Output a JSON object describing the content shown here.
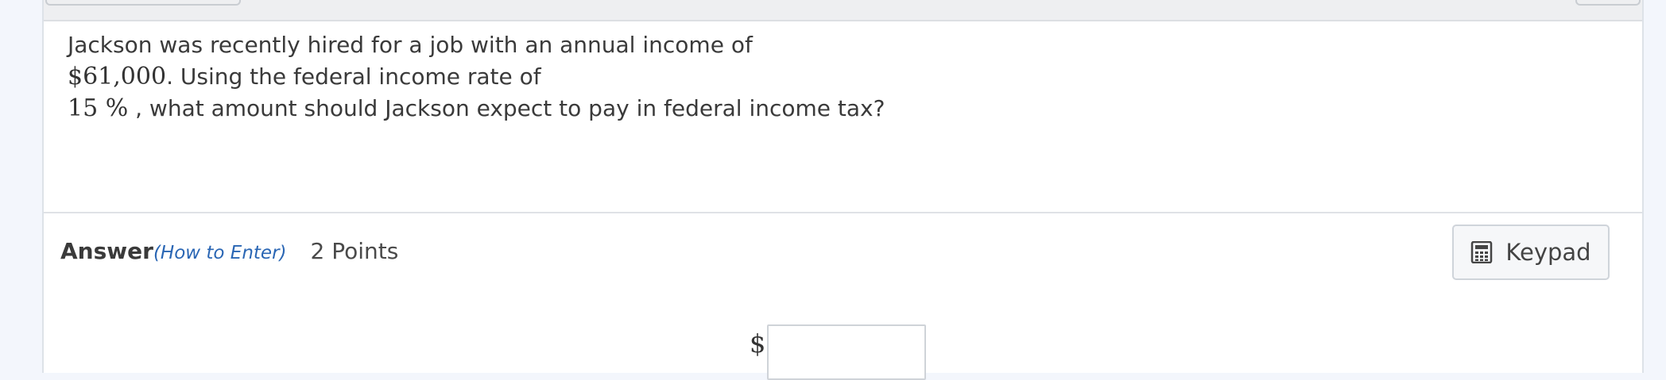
{
  "question": {
    "line1": "Jackson was recently hired for a job with an annual income of",
    "income": "$61,000",
    "line2": ". Using the federal income rate of",
    "rate": "15 %",
    "line3": " , what amount should Jackson expect to pay in federal income tax?"
  },
  "answer": {
    "label": "Answer",
    "how_to_enter": "(How to Enter)",
    "points": "2 Points",
    "currency_symbol": "$",
    "input_value": ""
  },
  "keypad": {
    "label": "Keypad",
    "icon": "calculator-icon"
  },
  "colors": {
    "link": "#2a66b4",
    "page_background": "#f3f6fc"
  }
}
